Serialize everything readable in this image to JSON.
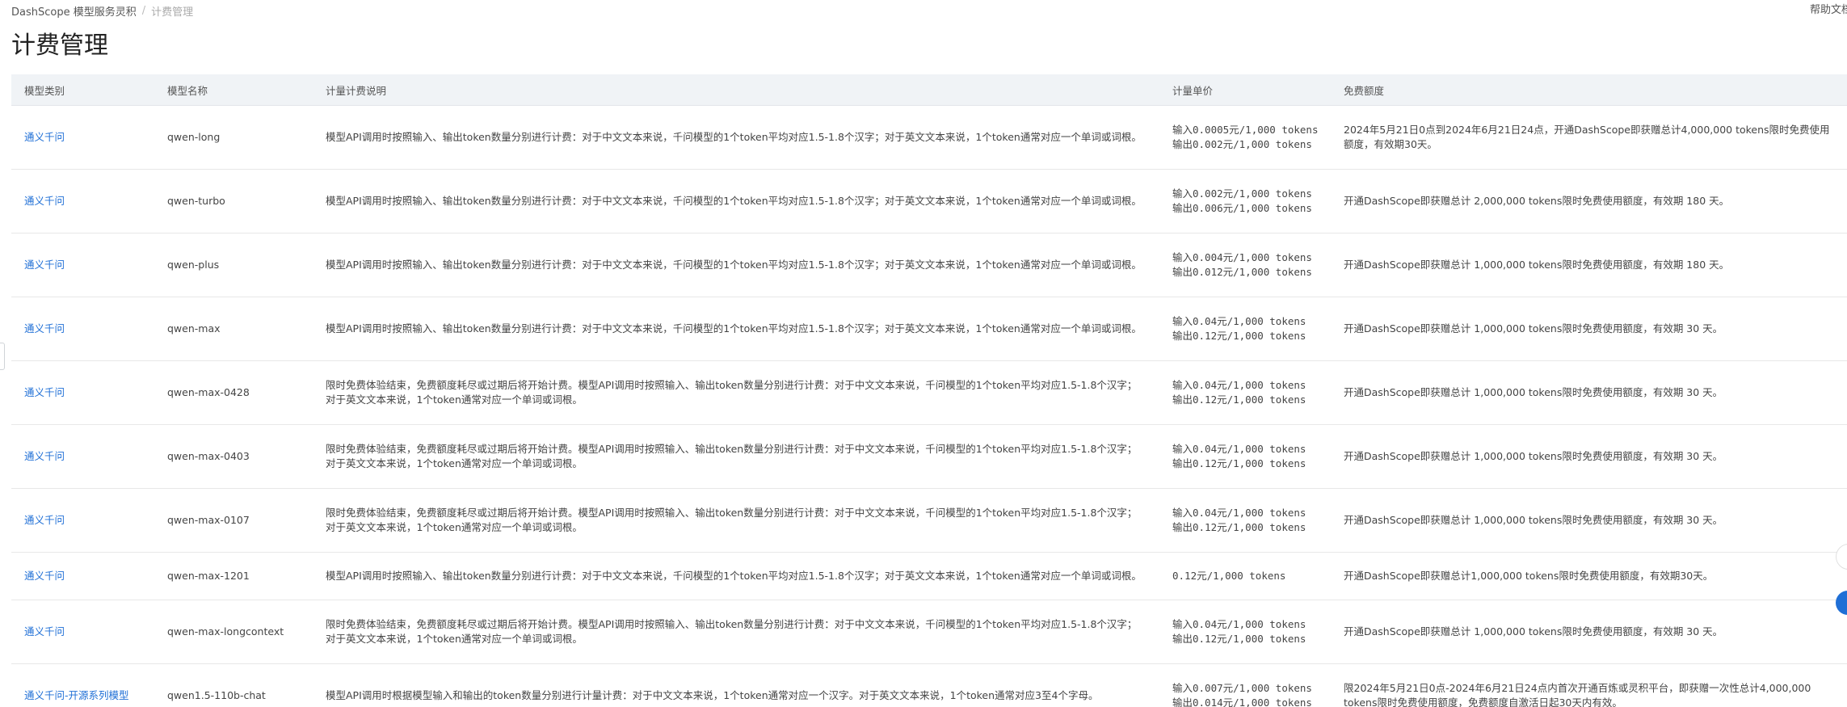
{
  "breadcrumb": {
    "root": "DashScope 模型服务灵积",
    "separator": "/",
    "current": "计费管理"
  },
  "help": {
    "label": "帮助文档"
  },
  "page": {
    "title": "计费管理"
  },
  "table": {
    "headers": [
      "模型类别",
      "模型名称",
      "计量计费说明",
      "计量单价",
      "免费额度"
    ],
    "rows": [
      {
        "category": "通义千问",
        "model": "qwen-long",
        "desc": "模型API调用时按照输入、输出token数量分别进行计费：对于中文文本来说，千问模型的1个token平均对应1.5-1.8个汉字；对于英文文本来说，1个token通常对应一个单词或词根。",
        "price": [
          "输入0.0005元/1,000 tokens",
          "输出0.002元/1,000 tokens"
        ],
        "quota": "2024年5月21日0点到2024年6月21日24点，开通DashScope即获赠总计4,000,000 tokens限时免费使用额度，有效期30天。"
      },
      {
        "category": "通义千问",
        "model": "qwen-turbo",
        "desc": "模型API调用时按照输入、输出token数量分别进行计费：对于中文文本来说，千问模型的1个token平均对应1.5-1.8个汉字；对于英文文本来说，1个token通常对应一个单词或词根。",
        "price": [
          "输入0.002元/1,000 tokens",
          "输出0.006元/1,000 tokens"
        ],
        "quota": "开通DashScope即获赠总计 2,000,000 tokens限时免费使用额度，有效期 180 天。"
      },
      {
        "category": "通义千问",
        "model": "qwen-plus",
        "desc": "模型API调用时按照输入、输出token数量分别进行计费：对于中文文本来说，千问模型的1个token平均对应1.5-1.8个汉字；对于英文文本来说，1个token通常对应一个单词或词根。",
        "price": [
          "输入0.004元/1,000 tokens",
          "输出0.012元/1,000 tokens"
        ],
        "quota": "开通DashScope即获赠总计 1,000,000 tokens限时免费使用额度，有效期 180 天。"
      },
      {
        "category": "通义千问",
        "model": "qwen-max",
        "desc": "模型API调用时按照输入、输出token数量分别进行计费：对于中文文本来说，千问模型的1个token平均对应1.5-1.8个汉字；对于英文文本来说，1个token通常对应一个单词或词根。",
        "price": [
          "输入0.04元/1,000 tokens",
          "输出0.12元/1,000 tokens"
        ],
        "quota": "开通DashScope即获赠总计 1,000,000 tokens限时免费使用额度，有效期 30 天。"
      },
      {
        "category": "通义千问",
        "model": "qwen-max-0428",
        "desc": "限时免费体验结束，免费额度耗尽或过期后将开始计费。模型API调用时按照输入、输出token数量分别进行计费：对于中文文本来说，千问模型的1个token平均对应1.5-1.8个汉字；对于英文文本来说，1个token通常对应一个单词或词根。",
        "price": [
          "输入0.04元/1,000 tokens",
          "输出0.12元/1,000 tokens"
        ],
        "quota": "开通DashScope即获赠总计 1,000,000 tokens限时免费使用额度，有效期 30 天。"
      },
      {
        "category": "通义千问",
        "model": "qwen-max-0403",
        "desc": "限时免费体验结束，免费额度耗尽或过期后将开始计费。模型API调用时按照输入、输出token数量分别进行计费：对于中文文本来说，千问模型的1个token平均对应1.5-1.8个汉字；对于英文文本来说，1个token通常对应一个单词或词根。",
        "price": [
          "输入0.04元/1,000 tokens",
          "输出0.12元/1,000 tokens"
        ],
        "quota": "开通DashScope即获赠总计 1,000,000 tokens限时免费使用额度，有效期 30 天。"
      },
      {
        "category": "通义千问",
        "model": "qwen-max-0107",
        "desc": "限时免费体验结束，免费额度耗尽或过期后将开始计费。模型API调用时按照输入、输出token数量分别进行计费：对于中文文本来说，千问模型的1个token平均对应1.5-1.8个汉字；对于英文文本来说，1个token通常对应一个单词或词根。",
        "price": [
          "输入0.04元/1,000 tokens",
          "输出0.12元/1,000 tokens"
        ],
        "quota": "开通DashScope即获赠总计 1,000,000 tokens限时免费使用额度，有效期 30 天。"
      },
      {
        "category": "通义千问",
        "model": "qwen-max-1201",
        "desc": "模型API调用时按照输入、输出token数量分别进行计费：对于中文文本来说，千问模型的1个token平均对应1.5-1.8个汉字；对于英文文本来说，1个token通常对应一个单词或词根。",
        "price": [
          "0.12元/1,000 tokens"
        ],
        "quota": "开通DashScope即获赠总计1,000,000 tokens限时免费使用额度，有效期30天。"
      },
      {
        "category": "通义千问",
        "model": "qwen-max-longcontext",
        "desc": "限时免费体验结束，免费额度耗尽或过期后将开始计费。模型API调用时按照输入、输出token数量分别进行计费：对于中文文本来说，千问模型的1个token平均对应1.5-1.8个汉字；对于英文文本来说，1个token通常对应一个单词或词根。",
        "price": [
          "输入0.04元/1,000 tokens",
          "输出0.12元/1,000 tokens"
        ],
        "quota": "开通DashScope即获赠总计 1,000,000 tokens限时免费使用额度，有效期 30 天。"
      },
      {
        "category": "通义千问-开源系列模型",
        "model": "qwen1.5-110b-chat",
        "desc": "模型API调用时根据模型输入和输出的token数量分别进行计量计费：对于中文文本来说，1个token通常对应一个汉字。对于英文文本来说，1个token通常对应3至4个字母。",
        "price": [
          "输入0.007元/1,000 tokens",
          "输出0.014元/1,000 tokens"
        ],
        "quota": "限2024年5月21日0点-2024年6月21日24点内首次开通百炼或灵积平台，即获赠一次性总计4,000,000 tokens限时免费使用额度，免费额度自激活日起30天内有效。"
      }
    ]
  }
}
